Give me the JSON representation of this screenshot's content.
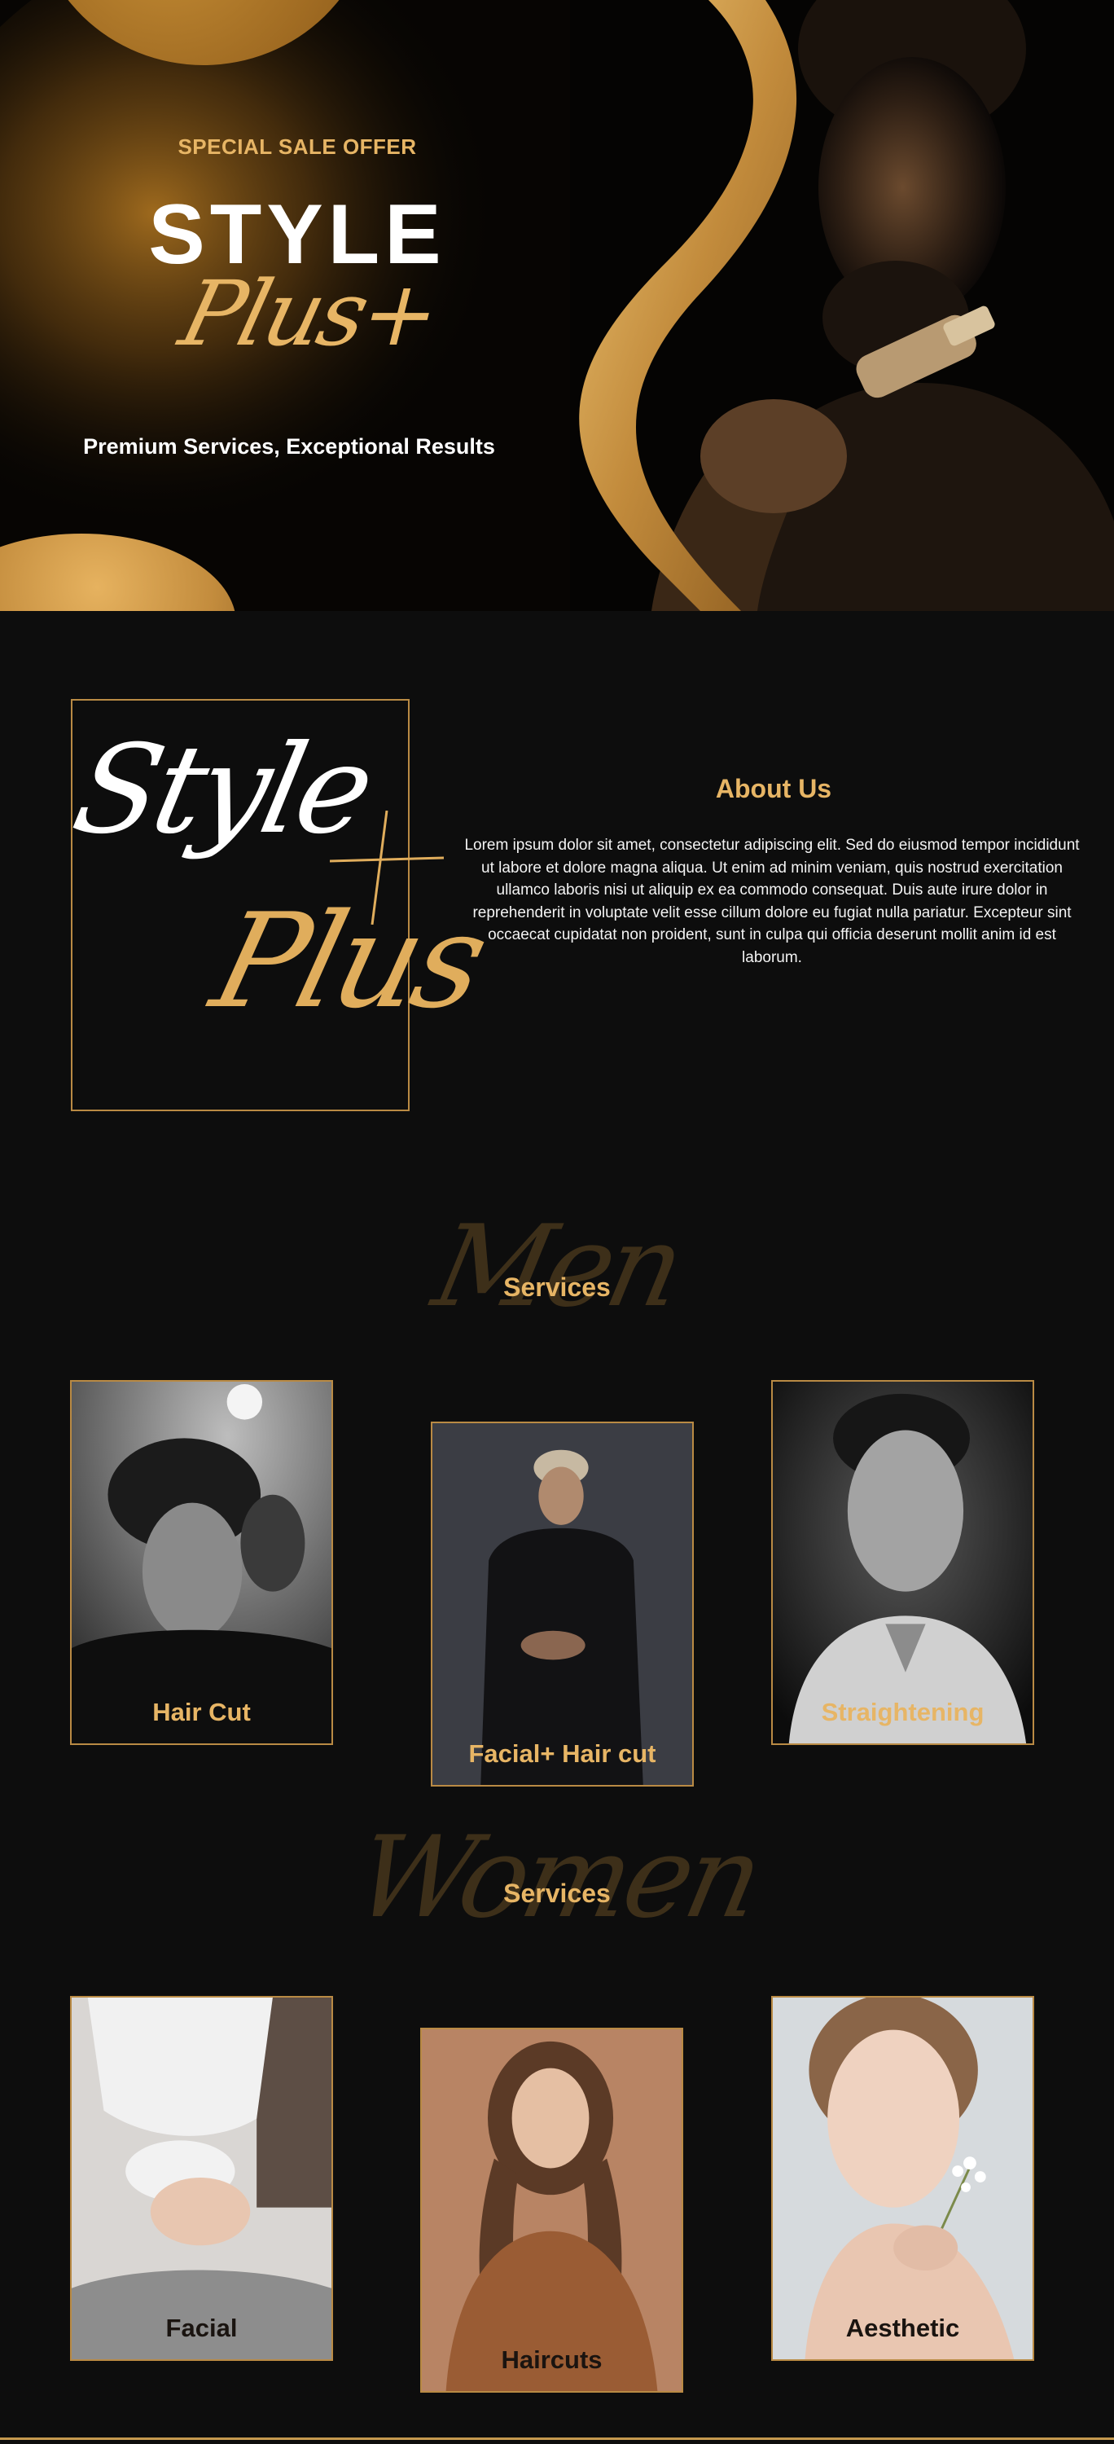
{
  "hero": {
    "sale_label": "SPECIAL SALE OFFER",
    "brand_main": "STYLE",
    "brand_script": "Plus+",
    "tagline": "Premium Services, Exceptional Results"
  },
  "about": {
    "logo_word_1": "Style",
    "logo_word_2": "Plus",
    "title": "About Us",
    "body": "Lorem ipsum dolor sit amet, consectetur adipiscing elit. Sed do eiusmod tempor incididunt ut labore et dolore magna aliqua. Ut enim ad minim veniam, quis nostrud exercitation ullamco laboris nisi ut aliquip ex ea commodo consequat. Duis aute irure dolor in reprehenderit in voluptate velit esse cillum dolore eu fugiat nulla pariatur. Excepteur sint occaecat cupidatat non proident, sunt in culpa qui officia deserunt mollit anim id est laborum."
  },
  "men": {
    "script": "Men",
    "heading": "Services",
    "cards": [
      {
        "label": "Hair Cut"
      },
      {
        "label": "Facial+ Hair cut"
      },
      {
        "label": "Straightening"
      }
    ]
  },
  "women": {
    "script": "Women",
    "heading": "Services",
    "cards": [
      {
        "label": "Facial"
      },
      {
        "label": "Haircuts"
      },
      {
        "label": "Aesthetic"
      }
    ]
  },
  "colors": {
    "accent_gold": "#e7b565",
    "frame_gold": "#b98a44",
    "background": "#0d0d0d"
  }
}
